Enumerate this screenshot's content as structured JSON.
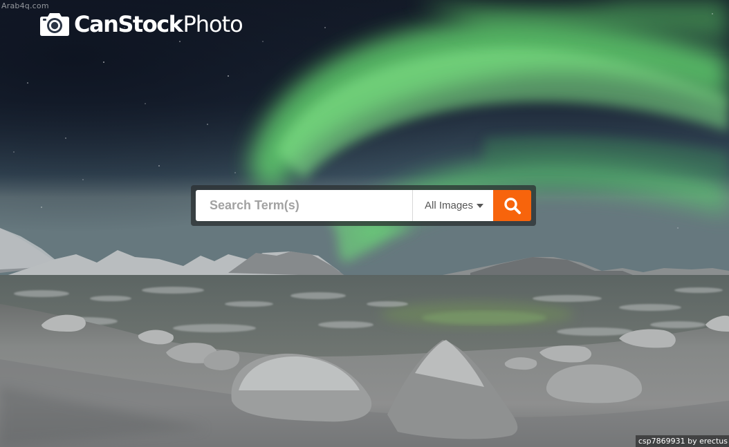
{
  "watermark": "Arab4q.com",
  "logo": {
    "strong": "CanStock",
    "light": "Photo"
  },
  "search": {
    "placeholder": "Search Term(s)",
    "type_label": "All Images",
    "button_icon": "search-icon"
  },
  "credit": "csp7869931 by erectus",
  "colors": {
    "accent": "#f7640c",
    "aurora": "#6fe07a",
    "sky": "#1a2233"
  }
}
